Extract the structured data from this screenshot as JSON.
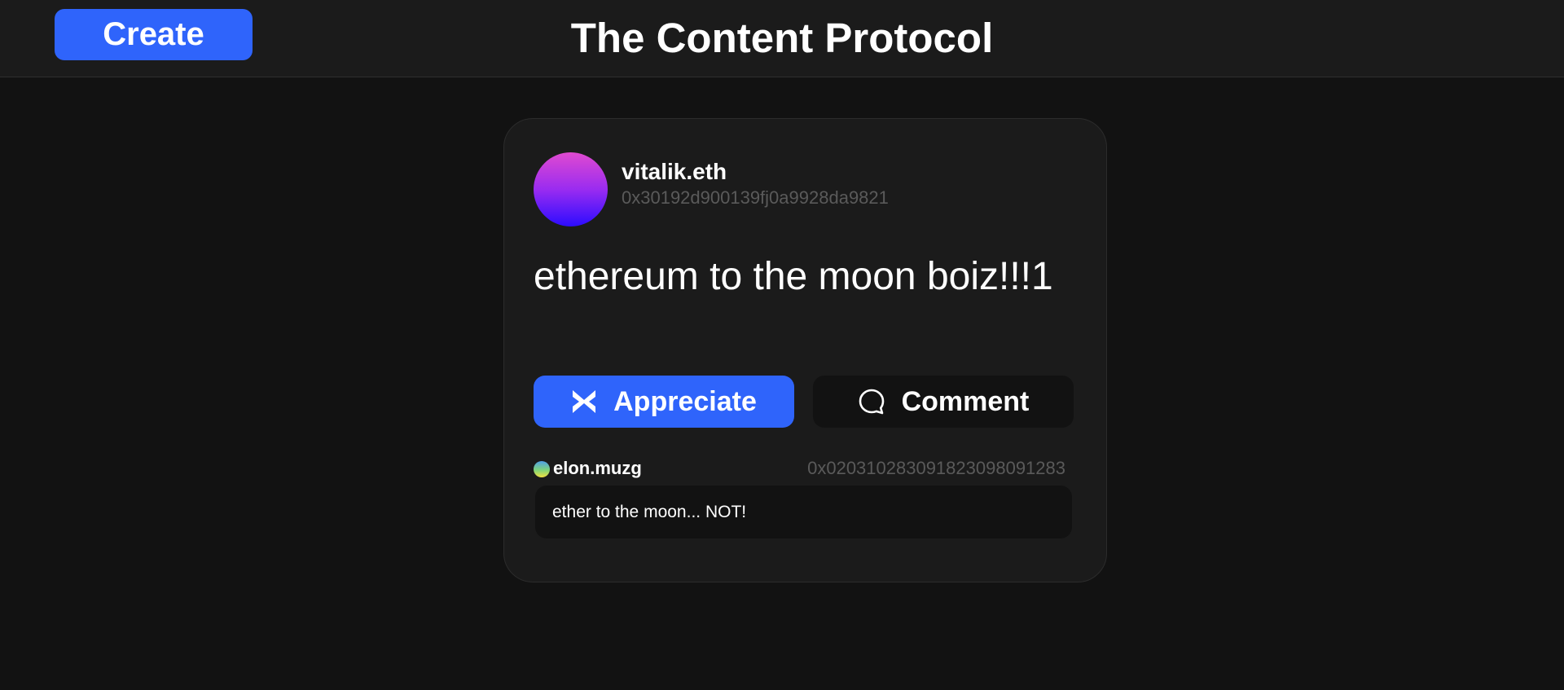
{
  "header": {
    "create_label": "Create",
    "title": "The Content Protocol"
  },
  "post": {
    "author_name": "vitalik.eth",
    "author_address": "0x30192d900139fj0a9928da9821",
    "text": "ethereum to the moon boiz!!!1",
    "avatar_icon": "gradient-avatar",
    "actions": {
      "appreciate_label": "Appreciate",
      "appreciate_icon": "appreciate-icon",
      "comment_label": "Comment",
      "comment_icon": "speech-bubble-icon"
    },
    "comments": [
      {
        "author_name": "elon.muzg",
        "author_address": "0x0203102830918230980912​83",
        "text": "ether to the moon... NOT!"
      }
    ]
  },
  "colors": {
    "accent": "#2f64fb",
    "background": "#121212",
    "surface": "#1b1b1b",
    "muted_text": "#5a5a5a"
  }
}
